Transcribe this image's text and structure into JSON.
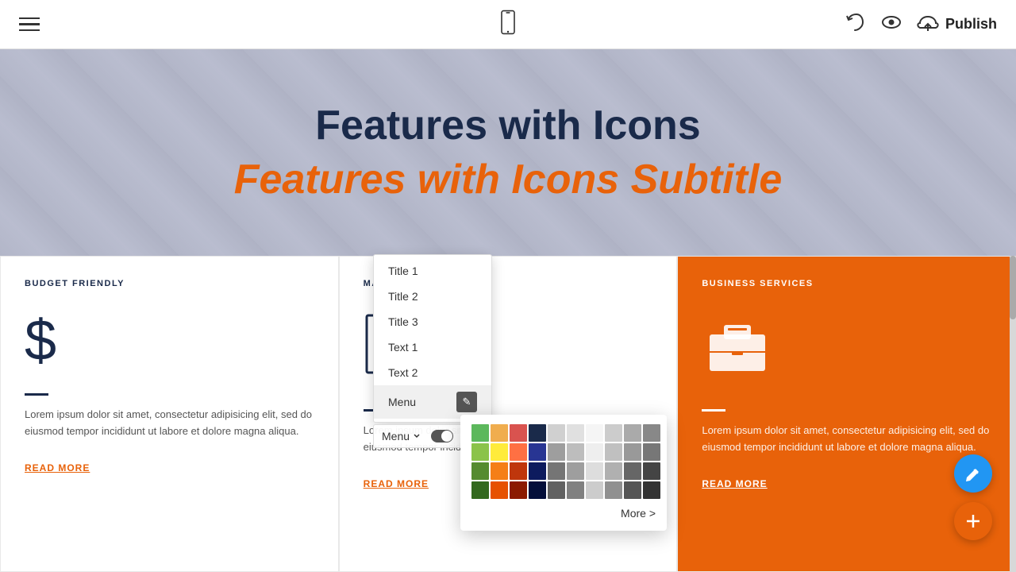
{
  "topbar": {
    "publish_label": "Publish"
  },
  "hero": {
    "title": "Features with Icons",
    "subtitle": "Features with Icons Subtitle"
  },
  "cards": [
    {
      "label": "BUDGET FRIENDLY",
      "icon": "$",
      "text": "Lorem ipsum dolor sit amet, consectetur adipisicing elit, sed do eiusmod tempor incididunt ut labore et dolore magna aliqua.",
      "link": "READ MORE"
    },
    {
      "label": "MARKET ANA...",
      "icon": "chart",
      "text": "Lorem ipsum dolor sit amet, consectetur adipisicing elit, sed do eiusmod tempor incididunt ut labore et dolore m...",
      "link": "READ MORE"
    },
    {
      "label": "BUSINESS SERVICES",
      "icon": "briefcase",
      "text": "Lorem ipsum dolor sit amet, consectetur adipisicing elit, sed do eiusmod tempor incididunt ut labore et dolore magna aliqua.",
      "link": "READ MORE"
    }
  ],
  "dropdown": {
    "items": [
      {
        "label": "Title 1"
      },
      {
        "label": "Title 2"
      },
      {
        "label": "Title 3"
      },
      {
        "label": "Text 1"
      },
      {
        "label": "Text 2"
      },
      {
        "label": "Menu",
        "active": true
      }
    ]
  },
  "menubar": {
    "label": "Menu"
  },
  "color_picker": {
    "more_label": "More >",
    "colors": [
      "#5cb85c",
      "#f0ad4e",
      "#d9534f",
      "#1a2a4a",
      "#d0d0d0",
      "#e0e0e0",
      "#f5f5f5",
      "#cccccc",
      "#aaaaaa",
      "#888888",
      "#8bc34a",
      "#ffeb3b",
      "#ff7043",
      "#283593",
      "#9e9e9e",
      "#bdbdbd",
      "#eeeeee",
      "#c0c0c0",
      "#999999",
      "#777777",
      "#558b2f",
      "#f57f17",
      "#bf360c",
      "#0d1b5e",
      "#757575",
      "#9e9e9e",
      "#dddddd",
      "#b0b0b0",
      "#666666",
      "#444444",
      "#33691e",
      "#e65100",
      "#8b1a00",
      "#040f3a",
      "#616161",
      "#808080",
      "#cccccc",
      "#909090",
      "#555555",
      "#333333"
    ]
  }
}
